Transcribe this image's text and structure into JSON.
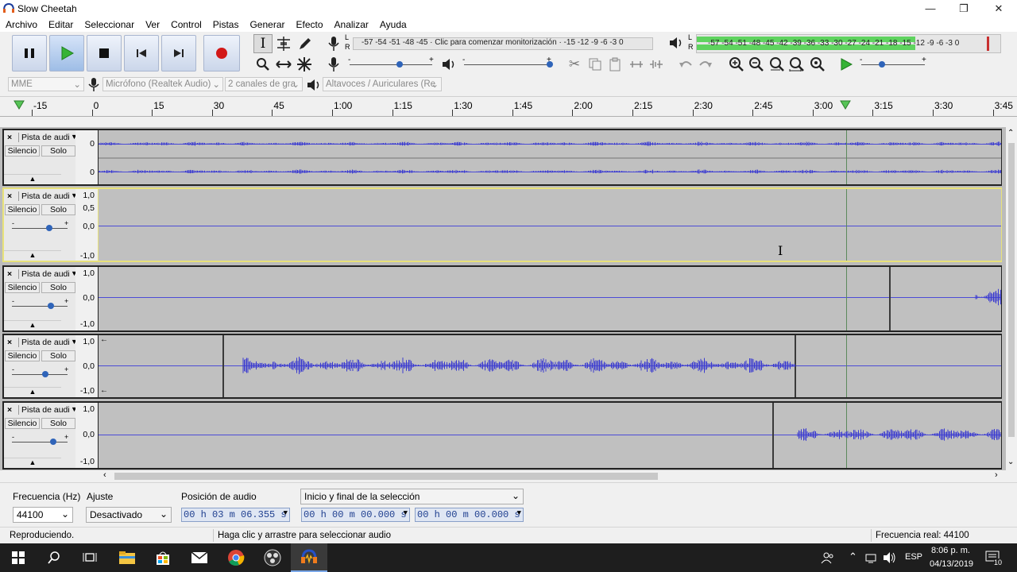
{
  "window": {
    "title": "Slow Cheetah"
  },
  "menu": [
    "Archivo",
    "Editar",
    "Seleccionar",
    "Ver",
    "Control",
    "Pistas",
    "Generar",
    "Efecto",
    "Analizar",
    "Ayuda"
  ],
  "meters": {
    "rec_scale": "-57 -54 -51 -48 -45 · Clic para comenzar monitorización · -15 -12  -9  -6  -3  0",
    "play_scale": "-57 -54 -51 -48 -45 -42 -39 -36 -33 -30 -27 -24 -21 -18 -15 -12  -9  -6  -3  0",
    "play_level_left": 0.72,
    "play_level_right": 0.72
  },
  "devices": {
    "host": "MME",
    "input": "Micrófono (Realtek Audio)",
    "channels": "2 canales de gra",
    "output": "Altavoces / Auriculares (Re"
  },
  "ruler": {
    "ticks": [
      "-15",
      "0",
      "15",
      "30",
      "45",
      "1:00",
      "1:15",
      "1:30",
      "1:45",
      "2:00",
      "2:15",
      "2:30",
      "2:45",
      "3:00",
      "3:15",
      "3:30",
      "3:45"
    ]
  },
  "tracks": [
    {
      "name": "Pista de audi",
      "mute": "Silencio",
      "solo": "Solo",
      "scale": [
        "0",
        "0"
      ]
    },
    {
      "name": "Pista de audi",
      "mute": "Silencio",
      "solo": "Solo",
      "scale": [
        "1,0",
        "0,5",
        "0,0",
        "-1,0"
      ]
    },
    {
      "name": "Pista de audi",
      "mute": "Silencio",
      "solo": "Solo",
      "scale": [
        "1,0",
        "0,0",
        "-1,0"
      ]
    },
    {
      "name": "Pista de audi",
      "mute": "Silencio",
      "solo": "Solo",
      "scale": [
        "1,0",
        "0,0",
        "-1,0"
      ]
    },
    {
      "name": "Pista de audi",
      "mute": "Silencio",
      "solo": "Solo",
      "scale": [
        "1,0",
        "0,0",
        "-1,0"
      ]
    }
  ],
  "selection_toolbar": {
    "rate_label": "Frecuencia (Hz)",
    "rate_value": "44100",
    "snap_label": "Ajuste",
    "snap_value": "Desactivado",
    "position_label": "Posición de audio",
    "position_value": "00 h 03 m 06.355 s",
    "selection_mode": "Inicio y final de la selección",
    "sel_start": "00 h 00 m 00.000 s",
    "sel_end": "00 h 00 m 00.000 s"
  },
  "status": {
    "state": "Reproduciendo.",
    "hint": "Haga clic y arrastre para seleccionar audio",
    "actual_rate": "Frecuencia real: 44100"
  },
  "taskbar": {
    "lang": "ESP",
    "time": "8:06 p. m.",
    "date": "04/13/2019",
    "notif_count": "10"
  }
}
